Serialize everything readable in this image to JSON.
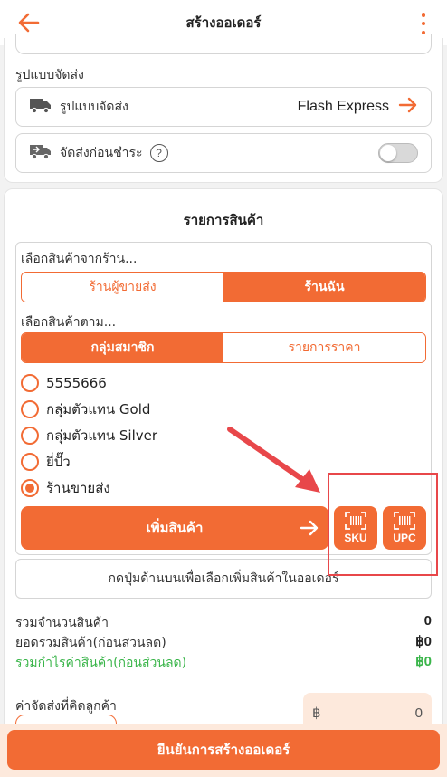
{
  "header": {
    "title": "สร้างออเดอร์",
    "back_icon": "arrow-left-icon",
    "menu_icon": "more-vertical-icon"
  },
  "shipping": {
    "section_label": "รูปแบบจัดส่ง",
    "method_label": "รูปแบบจัดส่ง",
    "method_value": "Flash Express",
    "cod_label": "จัดส่งก่อนชำระ",
    "cod_help": "?",
    "cod_enabled": false
  },
  "products": {
    "heading": "รายการสินค้า",
    "select_from_shop_label": "เลือกสินค้าจากร้าน...",
    "shop_tabs": [
      {
        "label": "ร้านผู้ขายส่ง",
        "active": false
      },
      {
        "label": "ร้านฉัน",
        "active": true
      }
    ],
    "select_by_label": "เลือกสินค้าตาม...",
    "by_tabs": [
      {
        "label": "กลุ่มสมาชิก",
        "active": true
      },
      {
        "label": "รายการราคา",
        "active": false
      }
    ],
    "groups": [
      {
        "label": "5555666",
        "selected": false
      },
      {
        "label": "กลุ่มตัวแทน Gold",
        "selected": false
      },
      {
        "label": "กลุ่มตัวแทน Silver",
        "selected": false
      },
      {
        "label": "ยี่ปั๊ว",
        "selected": false
      },
      {
        "label": "ร้านขายส่ง",
        "selected": true
      }
    ],
    "add_button": "เพิ่มสินค้า",
    "scan_sku": "SKU",
    "scan_upc": "UPC",
    "hint": "กดปุ่มด้านบนเพื่อเลือกเพิ่มสินค้าในออเดอร์"
  },
  "summary": {
    "total_qty_label": "รวมจำนวนสินค้า",
    "total_qty_value": "0",
    "subtotal_label": "ยอดรวมสินค้า(ก่อนส่วนลด)",
    "subtotal_value": "฿0",
    "profit_label": "รวมกำไรค่าสินค้า(ก่อนส่วนลด)",
    "profit_value": "฿0"
  },
  "shipping_fee": {
    "label": "ค่าจัดส่งที่คิดลูกค้า",
    "currency": "฿",
    "value": "0"
  },
  "footer": {
    "confirm_button": "ยืนยันการสร้างออเดอร์"
  },
  "colors": {
    "accent": "#f26b34",
    "accent_light": "#fde9dc",
    "profit_green": "#3ab54a",
    "annotation_red": "#e8474a"
  }
}
